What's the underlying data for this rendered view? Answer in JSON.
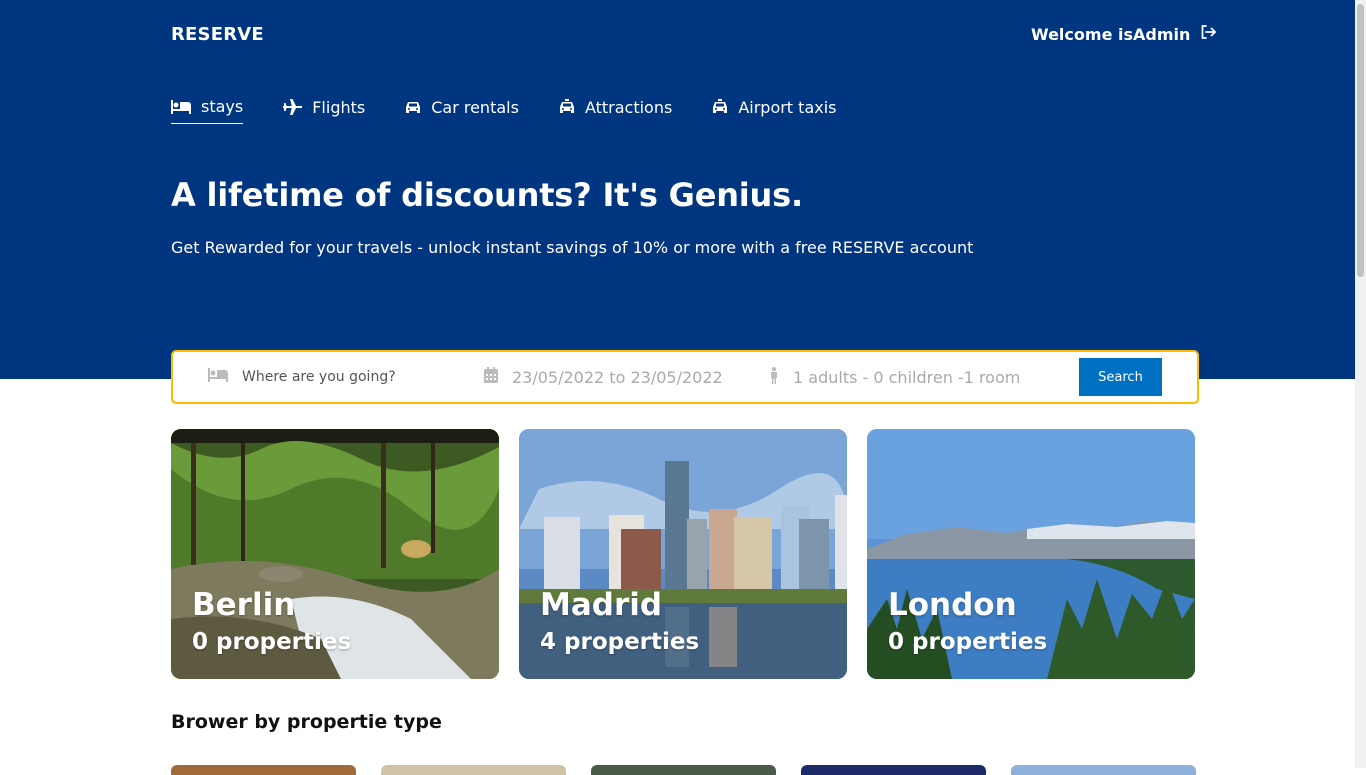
{
  "brand": {
    "logo": "RESERVE",
    "welcome": "Welcome isAdmin",
    "primary": "#003580",
    "accent": "#febb02",
    "button": "#0071c2"
  },
  "nav": {
    "items": [
      {
        "label": "stays",
        "icon": "bed-icon",
        "active": true
      },
      {
        "label": "Flights",
        "icon": "plane-icon",
        "active": false
      },
      {
        "label": "Car rentals",
        "icon": "car-icon",
        "active": false
      },
      {
        "label": "Attractions",
        "icon": "taxi-icon",
        "active": false
      },
      {
        "label": "Airport taxis",
        "icon": "taxi-icon",
        "active": false
      }
    ]
  },
  "hero": {
    "title": "A lifetime of discounts? It's Genius.",
    "subtitle": "Get Rewarded for your travels - unlock instant savings of 10% or more with a free RESERVE account"
  },
  "search": {
    "destination_placeholder": "Where are you going?",
    "dates": "23/05/2022 to 23/05/2022",
    "guests": "1 adults - 0 children -1 room",
    "button": "Search"
  },
  "cities": [
    {
      "name": "Berlin",
      "count": "0 properties"
    },
    {
      "name": "Madrid",
      "count": "4 properties"
    },
    {
      "name": "London",
      "count": "0 properties"
    }
  ],
  "property_section": {
    "title": "Brower by propertie type"
  }
}
